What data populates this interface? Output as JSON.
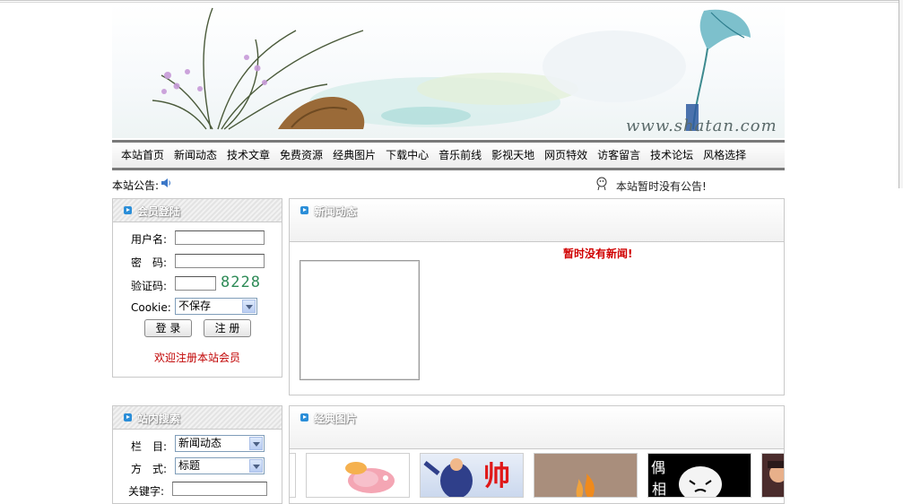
{
  "banner": {
    "site_url": "www.shatan.com"
  },
  "nav": {
    "items": [
      "本站首页",
      "新闻动态",
      "技术文章",
      "免费资源",
      "经典图片",
      "下载中心",
      "音乐前线",
      "影视天地",
      "网页特效",
      "访客留言",
      "技术论坛",
      "风格选择"
    ]
  },
  "notice": {
    "label": "本站公告:",
    "message": "本站暂时没有公告!"
  },
  "login": {
    "title": "会员登陆",
    "username_label": "用户名:",
    "password_label": "密　码:",
    "captcha_label": "验证码:",
    "captcha_code": "8228",
    "cookie_label": "Cookie:",
    "cookie_selected": "不保存",
    "login_button": "登 录",
    "register_button": "注 册",
    "welcome": "欢迎注册本站会员"
  },
  "news": {
    "title": "新闻动态",
    "empty_message": "暂时没有新闻!"
  },
  "search": {
    "title": "站内搜索",
    "column_label": "栏　目:",
    "column_selected": "新闻动态",
    "method_label": "方　式:",
    "method_selected": "标题",
    "keyword_label": "关键字:"
  },
  "gallery": {
    "title": "经典图片",
    "thumb_text_1": "帅",
    "thumb_text_2": "偶",
    "thumb_text_3": "相"
  }
}
